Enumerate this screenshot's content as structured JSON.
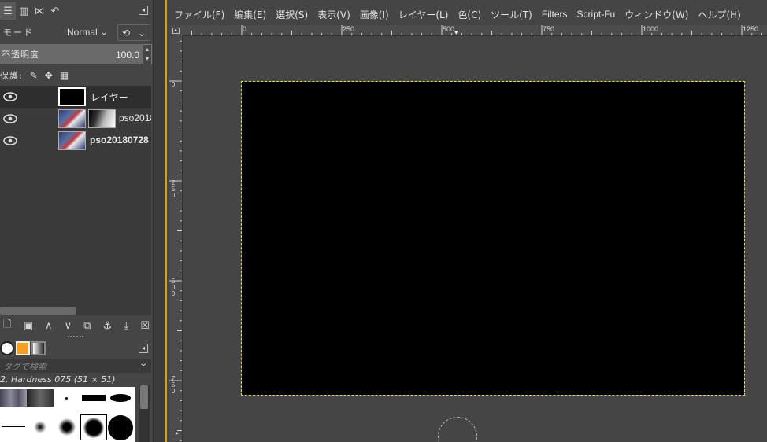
{
  "dock": {
    "mode_label": "モード",
    "mode_value": "Normal",
    "opacity_label": "不透明度",
    "opacity_value": "100.0",
    "lock_label": "保護:",
    "layers": [
      {
        "name": "レイヤー",
        "thumb": "black",
        "mask": false,
        "selected": true
      },
      {
        "name": "pso2018",
        "thumb": "photo",
        "mask": true,
        "selected": false
      },
      {
        "name": "pso20180728",
        "thumb": "photo",
        "mask": false,
        "selected": false
      }
    ],
    "tag_search_placeholder": "タグで検索",
    "brush_name": "2. Hardness 075 (51 × 51)"
  },
  "menubar": {
    "items": [
      "ファイル(F)",
      "編集(E)",
      "選択(S)",
      "表示(V)",
      "画像(I)",
      "レイヤー(L)",
      "色(C)",
      "ツール(T)",
      "Filters",
      "Script-Fu",
      "ウィンドウ(W)",
      "ヘルプ(H)"
    ]
  },
  "ruler": {
    "h_labels": [
      "0",
      "250",
      "500",
      "750",
      "1000",
      "1250"
    ],
    "v_labels": [
      "0",
      "250",
      "500",
      "750"
    ]
  },
  "icons": {
    "tabs": [
      "layers-icon",
      "channels-icon",
      "paths-icon",
      "undo-history-icon"
    ],
    "lock": [
      "lock-pixels-icon",
      "lock-position-icon",
      "lock-alpha-icon"
    ],
    "layer_actions": [
      "new-layer-icon",
      "new-layer-group-icon",
      "raise-layer-icon",
      "lower-layer-icon",
      "duplicate-layer-icon",
      "anchor-layer-icon",
      "merge-down-icon",
      "delete-layer-icon"
    ]
  },
  "colors": {
    "accent": "#d8a200",
    "selection": "#e8d850",
    "background": "#454545"
  }
}
